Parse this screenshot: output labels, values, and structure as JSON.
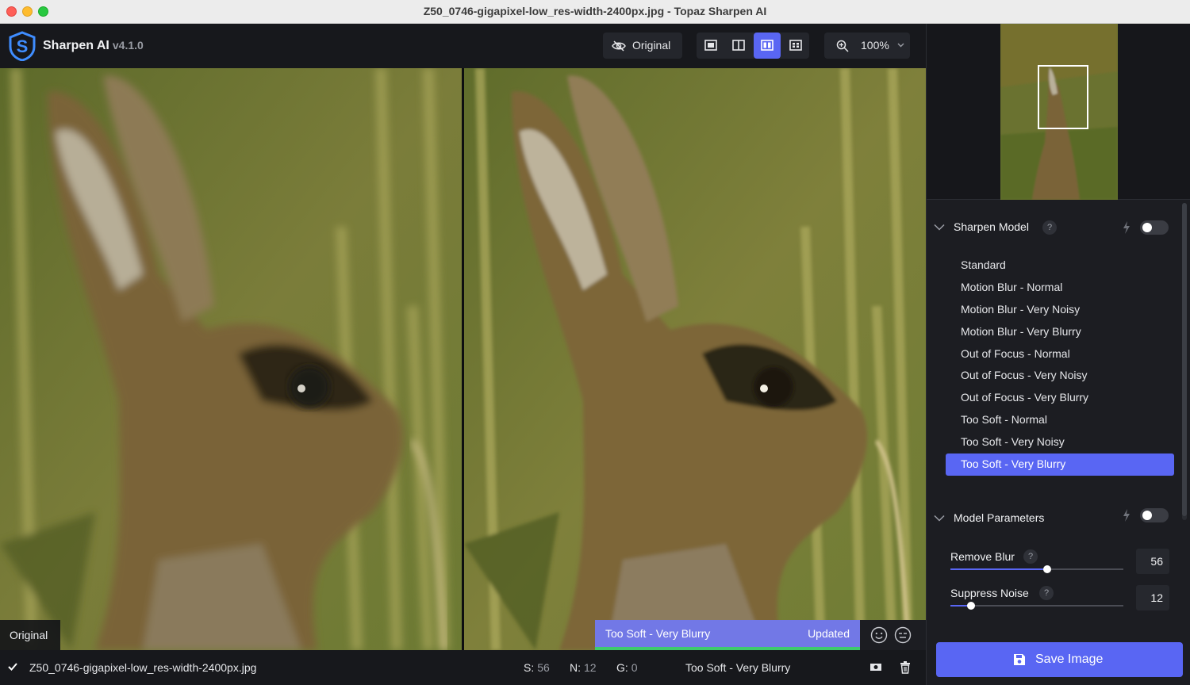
{
  "window": {
    "title": "Z50_0746-gigapixel-low_res-width-2400px.jpg - Topaz Sharpen AI"
  },
  "app": {
    "name": "Sharpen AI",
    "version": "v4.1.0"
  },
  "toolbar": {
    "original_label": "Original",
    "views": [
      "single-view",
      "split-view",
      "side-by-side-view",
      "quad-view"
    ],
    "active_view": "side-by-side-view",
    "zoom_label": "100%"
  },
  "preview": {
    "left_label": "Original",
    "model_name": "Too Soft - Very Blurry",
    "status": "Updated"
  },
  "bottom": {
    "filename": "Z50_0746-gigapixel-low_res-width-2400px.jpg",
    "s_label": "S:",
    "s_value": "56",
    "n_label": "N:",
    "n_value": "12",
    "g_label": "G:",
    "g_value": "0",
    "model": "Too Soft - Very Blurry"
  },
  "sharpen_model": {
    "title": "Sharpen Model",
    "help": "?",
    "auto_enabled": false,
    "models": [
      "Standard",
      "Motion Blur - Normal",
      "Motion Blur - Very Noisy",
      "Motion Blur - Very Blurry",
      "Out of Focus - Normal",
      "Out of Focus - Very Noisy",
      "Out of Focus - Very Blurry",
      "Too Soft - Normal",
      "Too Soft - Very Noisy",
      "Too Soft - Very Blurry"
    ],
    "selected_index": 9
  },
  "model_parameters": {
    "title": "Model Parameters",
    "auto_enabled": false,
    "remove_blur": {
      "label": "Remove Blur",
      "help": "?",
      "value": "56",
      "fraction": 0.56
    },
    "suppress_noise": {
      "label": "Suppress Noise",
      "help": "?",
      "value": "12",
      "fraction": 0.12
    }
  },
  "save": {
    "label": "Save Image"
  },
  "colors": {
    "accent": "#5966f3",
    "status_green": "#3ecb6d"
  }
}
